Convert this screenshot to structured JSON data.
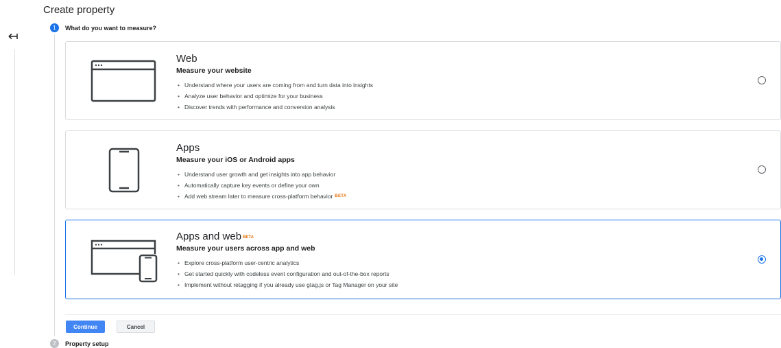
{
  "page": {
    "title": "Create property"
  },
  "stepper": {
    "step1": {
      "number": "1",
      "label": "What do you want to measure?"
    },
    "step2": {
      "number": "2",
      "label": "Property setup"
    }
  },
  "cards": {
    "web": {
      "title": "Web",
      "subtitle": "Measure your website",
      "bullets": [
        "Understand where your users are coming from and turn data into insights",
        "Analyze user behavior and optimize for your business",
        "Discover trends with performance and conversion analysis"
      ],
      "selected": false,
      "icon": "browser-window-icon"
    },
    "apps": {
      "title": "Apps",
      "subtitle": "Measure your iOS or Android apps",
      "bullets": [
        "Understand user growth and get insights into app behavior",
        "Automatically capture key events or define your own",
        "Add web stream later to measure cross-platform behavior"
      ],
      "bullet3_badge": "BETA",
      "selected": false,
      "icon": "mobile-phone-icon"
    },
    "apps_web": {
      "title": "Apps and web",
      "title_badge": "BETA",
      "subtitle": "Measure your users across app and web",
      "bullets": [
        "Explore cross-platform user-centric analytics",
        "Get started quickly with codeless event configuration and out-of-the-box reports",
        "Implement without retagging if you already use gtag.js or Tag Manager on your site"
      ],
      "selected": true,
      "icon": "browser-and-phone-icon"
    }
  },
  "buttons": {
    "continue": "Continue",
    "cancel": "Cancel"
  },
  "colors": {
    "accent": "#1a73e8",
    "continue_bg": "#4285f4",
    "beta": "#e8710a"
  },
  "icons": {
    "back": "back-arrow-icon"
  }
}
